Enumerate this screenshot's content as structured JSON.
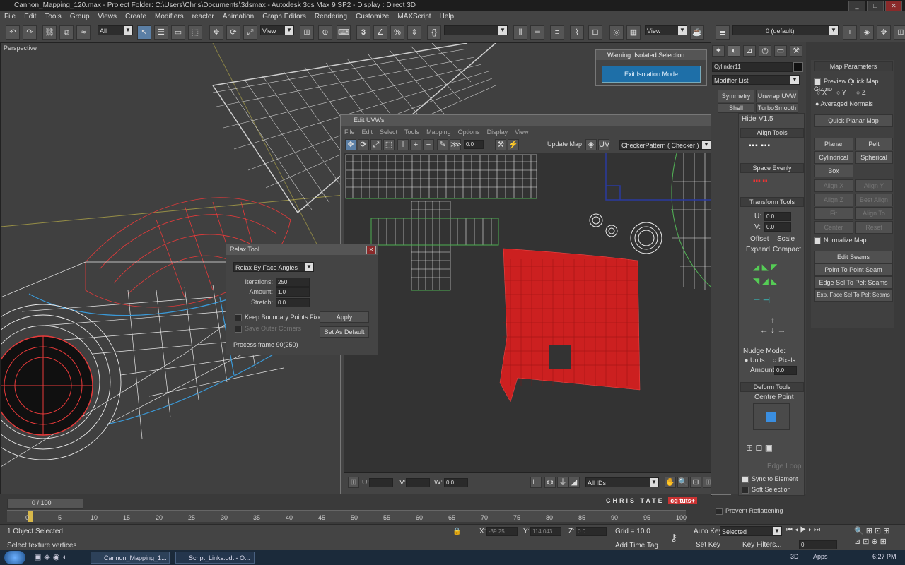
{
  "window": {
    "title": "Cannon_Mapping_120.max    - Project Folder: C:\\Users\\Chris\\Documents\\3dsmax    - Autodesk 3ds Max 9 SP2    - Display : Direct 3D",
    "controls": [
      "_",
      "□",
      "✕"
    ]
  },
  "menubar": [
    "File",
    "Edit",
    "Tools",
    "Group",
    "Views",
    "Create",
    "Modifiers",
    "reactor",
    "Animation",
    "Graph Editors",
    "Rendering",
    "Customize",
    "MAXScript",
    "Help"
  ],
  "toolbar": {
    "selection_filter": "All",
    "coord_system": "View",
    "named_selection": "",
    "view2": "View",
    "layer": "0 (default)"
  },
  "viewport": {
    "label": "Perspective"
  },
  "warning_dialog": {
    "title": "Warning: Isolated Selection",
    "button": "Exit Isolation Mode"
  },
  "edit_uvws": {
    "title": "Edit UVWs",
    "menu": [
      "File",
      "Edit",
      "Select",
      "Tools",
      "Mapping",
      "Options",
      "Display",
      "View"
    ],
    "spinner_value": "0.0",
    "update_map": "Update Map",
    "texture": "CheckerPattern  ( Checker )",
    "u_label": "U:",
    "v_label": "V:",
    "w_label": "W:",
    "w_value": "0.0",
    "ids": "All IDs"
  },
  "relax_tool": {
    "title": "Relax Tool",
    "mode": "Relax By Face Angles",
    "iterations_label": "Iterations:",
    "iterations": "250",
    "amount_label": "Amount:",
    "amount": "1.0",
    "stretch_label": "Stretch:",
    "stretch": "0.0",
    "keep_boundary": "Keep Boundary Points Fixed",
    "save_outer": "Save Outer Corners",
    "apply": "Apply",
    "set_default": "Set As Default",
    "status": "Process frame 90(250)"
  },
  "command_panel": {
    "object_name": "Cylinder11",
    "modifier_list": "Modifier List",
    "buttons": [
      "Symmetry",
      "Unwrap UVW",
      "Shell",
      "TurboSmooth"
    ],
    "hide": "Hide",
    "version": "V1.5",
    "align_tools": "Align Tools",
    "space_evenly": "Space Evenly",
    "transform_tools": "Transform Tools",
    "u_label": "U:",
    "u_value": "0.0",
    "v_label": "V:",
    "v_value": "0.0",
    "offset": "Offset",
    "scale": "Scale",
    "expand": "Expand",
    "compact": "Compact",
    "nudge_mode": "Nudge Mode:",
    "units": "Units",
    "pixels": "Pixels",
    "amount_label": "Amount:",
    "amount_value": "0.0",
    "deform_tools": "Deform Tools",
    "centre_point": "Centre Point",
    "edge_loop": "Edge Loop",
    "sync": "Sync to Element",
    "soft_selection": "Soft Selection",
    "prevent": "Prevent Reflattening"
  },
  "map_params": {
    "title": "Map Parameters",
    "preview": "Preview Quick Map Gizmo",
    "axes": [
      "X",
      "Y",
      "Z"
    ],
    "averaged": "Averaged Normals",
    "quick_planar": "Quick Planar Map",
    "planar": "Planar",
    "pelt": "Pelt",
    "cylindrical": "Cylindrical",
    "spherical": "Spherical",
    "box": "Box",
    "alignx": "Align X",
    "aligny": "Align Y",
    "alignz": "Align Z",
    "best_align": "Best Align",
    "fit": "Fit",
    "align_to_view": "Align To View",
    "center": "Center",
    "reset": "Reset",
    "normalize": "Normalize Map",
    "edit_seams": "Edit Seams",
    "point_to_point": "Point To Point Seam",
    "edge_sel": "Edge Sel To Pelt Seams",
    "exp_face": "Exp. Face Sel To Pelt Seams"
  },
  "timeline": {
    "frame": "0 / 100",
    "ticks": [
      "0",
      "5",
      "10",
      "15",
      "20",
      "25",
      "30",
      "35",
      "40",
      "45",
      "50",
      "55",
      "60",
      "65",
      "70",
      "75",
      "80",
      "85",
      "90",
      "95",
      "100"
    ],
    "brand": "CHRIS TATE",
    "logo": "cg tuts+"
  },
  "statusbar": {
    "objects": "1 Object Selected",
    "prompt": "Select texture vertices",
    "x_label": "X:",
    "x_value": "-39.25",
    "y_label": "Y:",
    "y_value": "114.043",
    "z_label": "Z:",
    "z_value": "0.0",
    "grid": "Grid = 10.0",
    "add_time_tag": "Add Time Tag",
    "auto_key": "Auto Key",
    "selected": "Selected",
    "set_key": "Set Key",
    "key_filters": "Key Filters...",
    "frame_field": "0"
  },
  "taskbar": {
    "items": [
      "Cannon_Mapping_1...",
      "Script_Links.odt - O..."
    ],
    "tray": [
      "3D",
      "Apps"
    ],
    "time": "6:27 PM"
  }
}
